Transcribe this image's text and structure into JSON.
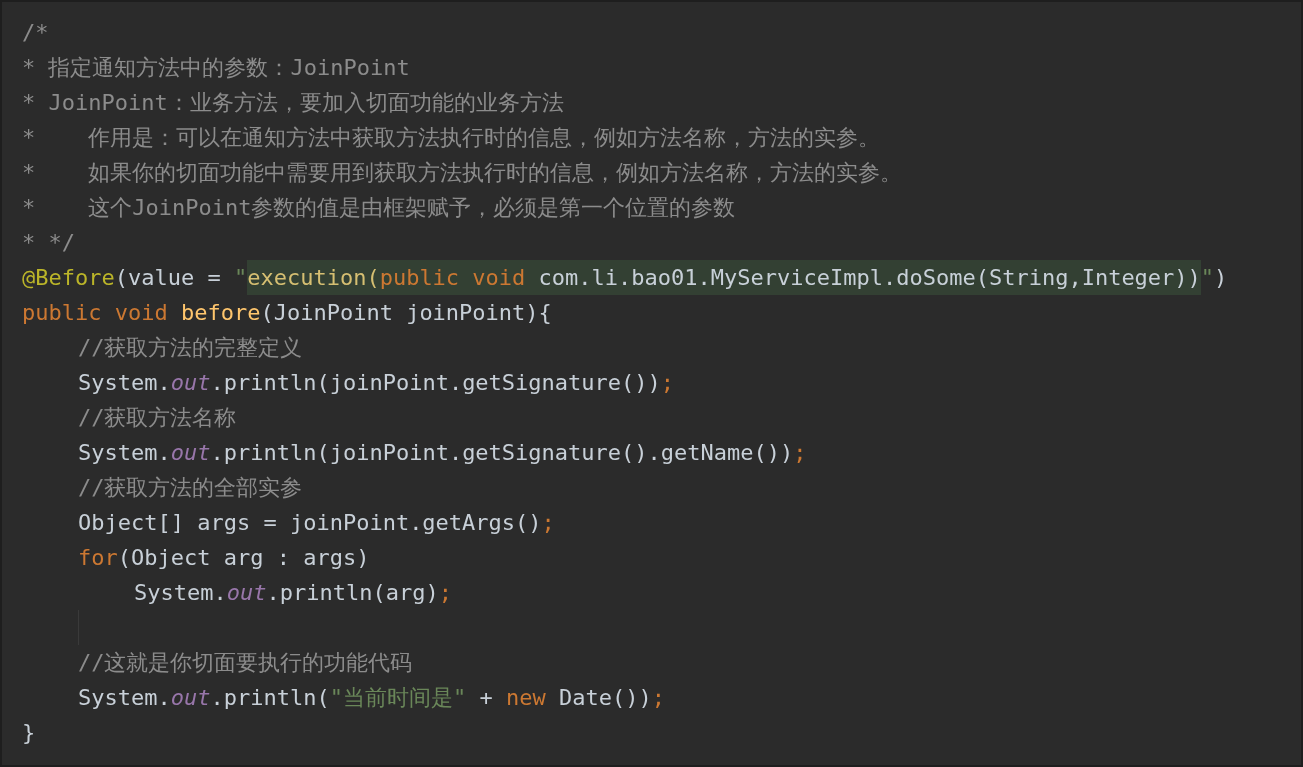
{
  "editor": {
    "lines": [
      {
        "tokens": [
          {
            "kind": "comment",
            "text": "/*"
          }
        ]
      },
      {
        "tokens": [
          {
            "kind": "comment",
            "text": "* 指定通知方法中的参数：JoinPoint"
          }
        ]
      },
      {
        "tokens": [
          {
            "kind": "comment",
            "text": "* JoinPoint：业务方法，要加入切面功能的业务方法"
          }
        ]
      },
      {
        "tokens": [
          {
            "kind": "comment",
            "text": "*    作用是：可以在通知方法中获取方法执行时的信息，例如方法名称，方法的实参。"
          }
        ]
      },
      {
        "tokens": [
          {
            "kind": "comment",
            "text": "*    如果你的切面功能中需要用到获取方法执行时的信息，例如方法名称，方法的实参。"
          }
        ]
      },
      {
        "tokens": [
          {
            "kind": "comment",
            "text": "*    这个JoinPoint参数的值是由框架赋予，必须是第一个位置的参数"
          }
        ]
      },
      {
        "tokens": [
          {
            "kind": "comment",
            "text": "* */"
          }
        ]
      },
      {
        "tokens": [
          {
            "kind": "annotation",
            "text": "@Before"
          },
          {
            "kind": "plain",
            "text": "(value = "
          },
          {
            "kind": "string",
            "text": "\""
          },
          {
            "kind": "inj_method",
            "text": "execution("
          },
          {
            "kind": "inj_keyword",
            "text": "public void "
          },
          {
            "kind": "inj_plain",
            "text": "com.li.bao01.MyServiceImpl.doSome(String,Integer))"
          },
          {
            "kind": "string",
            "text": "\""
          },
          {
            "kind": "plain",
            "text": ")"
          }
        ]
      },
      {
        "tokens": [
          {
            "kind": "keyword",
            "text": "public void "
          },
          {
            "kind": "method",
            "text": "before"
          },
          {
            "kind": "plain",
            "text": "(JoinPoint joinPoint){"
          }
        ],
        "children": [
          {
            "tokens": [
              {
                "kind": "comment",
                "text": "//获取方法的完整定义"
              }
            ]
          },
          {
            "tokens": [
              {
                "kind": "plain",
                "text": "System."
              },
              {
                "kind": "field",
                "text": "out"
              },
              {
                "kind": "plain",
                "text": ".println(joinPoint.getSignature())"
              },
              {
                "kind": "punct",
                "text": ";"
              }
            ]
          },
          {
            "tokens": [
              {
                "kind": "comment",
                "text": "//获取方法名称"
              }
            ]
          },
          {
            "tokens": [
              {
                "kind": "plain",
                "text": "System."
              },
              {
                "kind": "field",
                "text": "out"
              },
              {
                "kind": "plain",
                "text": ".println(joinPoint.getSignature().getName())"
              },
              {
                "kind": "punct",
                "text": ";"
              }
            ]
          },
          {
            "tokens": [
              {
                "kind": "comment",
                "text": "//获取方法的全部实参"
              }
            ]
          },
          {
            "tokens": [
              {
                "kind": "plain",
                "text": "Object[] args = joinPoint.getArgs()"
              },
              {
                "kind": "punct",
                "text": ";"
              }
            ]
          },
          {
            "tokens": [
              {
                "kind": "keyword",
                "text": "for"
              },
              {
                "kind": "plain",
                "text": "(Object arg : args)"
              }
            ],
            "children": [
              {
                "tokens": [
                  {
                    "kind": "plain",
                    "text": "System."
                  },
                  {
                    "kind": "field",
                    "text": "out"
                  },
                  {
                    "kind": "plain",
                    "text": ".println(arg)"
                  },
                  {
                    "kind": "punct",
                    "text": ";"
                  }
                ]
              }
            ]
          },
          {
            "kind": "blank"
          },
          {
            "tokens": [
              {
                "kind": "comment",
                "text": "//这就是你切面要执行的功能代码"
              }
            ]
          },
          {
            "tokens": [
              {
                "kind": "plain",
                "text": "System."
              },
              {
                "kind": "field",
                "text": "out"
              },
              {
                "kind": "plain",
                "text": ".println("
              },
              {
                "kind": "string",
                "text": "\"当前时间是\""
              },
              {
                "kind": "plain",
                "text": " + "
              },
              {
                "kind": "keyword",
                "text": "new "
              },
              {
                "kind": "plain",
                "text": "Date())"
              },
              {
                "kind": "punct",
                "text": ";"
              }
            ]
          }
        ]
      },
      {
        "tokens": [
          {
            "kind": "plain",
            "text": "}"
          }
        ]
      }
    ]
  }
}
